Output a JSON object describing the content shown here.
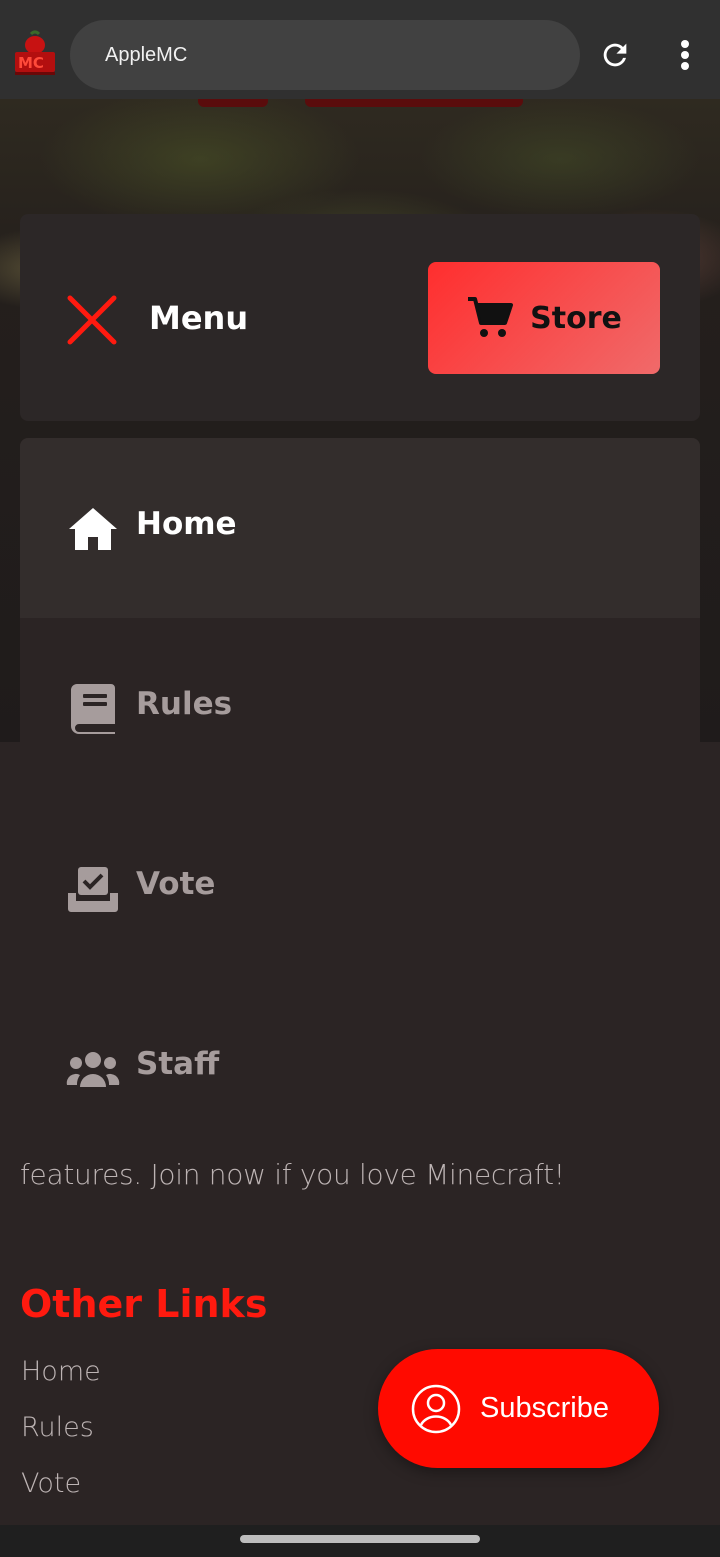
{
  "browser": {
    "url_text": "AppleMC",
    "icons": {
      "logo": "applemc-logo-icon",
      "reload": "reload-icon",
      "more": "more-vertical-icon"
    }
  },
  "menu": {
    "label": "Menu",
    "close_icon": "close-icon",
    "store": {
      "label": "Store",
      "icon": "cart-icon"
    }
  },
  "nav": {
    "items": [
      {
        "label": "Home",
        "icon": "home-icon",
        "active": true
      },
      {
        "label": "Rules",
        "icon": "book-icon",
        "active": false
      },
      {
        "label": "Vote",
        "icon": "vote-box-icon",
        "active": false
      },
      {
        "label": "Staff",
        "icon": "users-icon",
        "active": false
      }
    ]
  },
  "page": {
    "intro_tail": "features. Join now if you love Minecraft!",
    "other_links_title": "Other Links",
    "other_links": [
      "Home",
      "Rules",
      "Vote"
    ]
  },
  "subscribe": {
    "label": "Subscribe",
    "icon": "user-circle-icon"
  },
  "colors": {
    "accent": "#ff0a00",
    "link_red": "#ff1a0f",
    "background": "#2b2424",
    "card": "#2c2727"
  }
}
